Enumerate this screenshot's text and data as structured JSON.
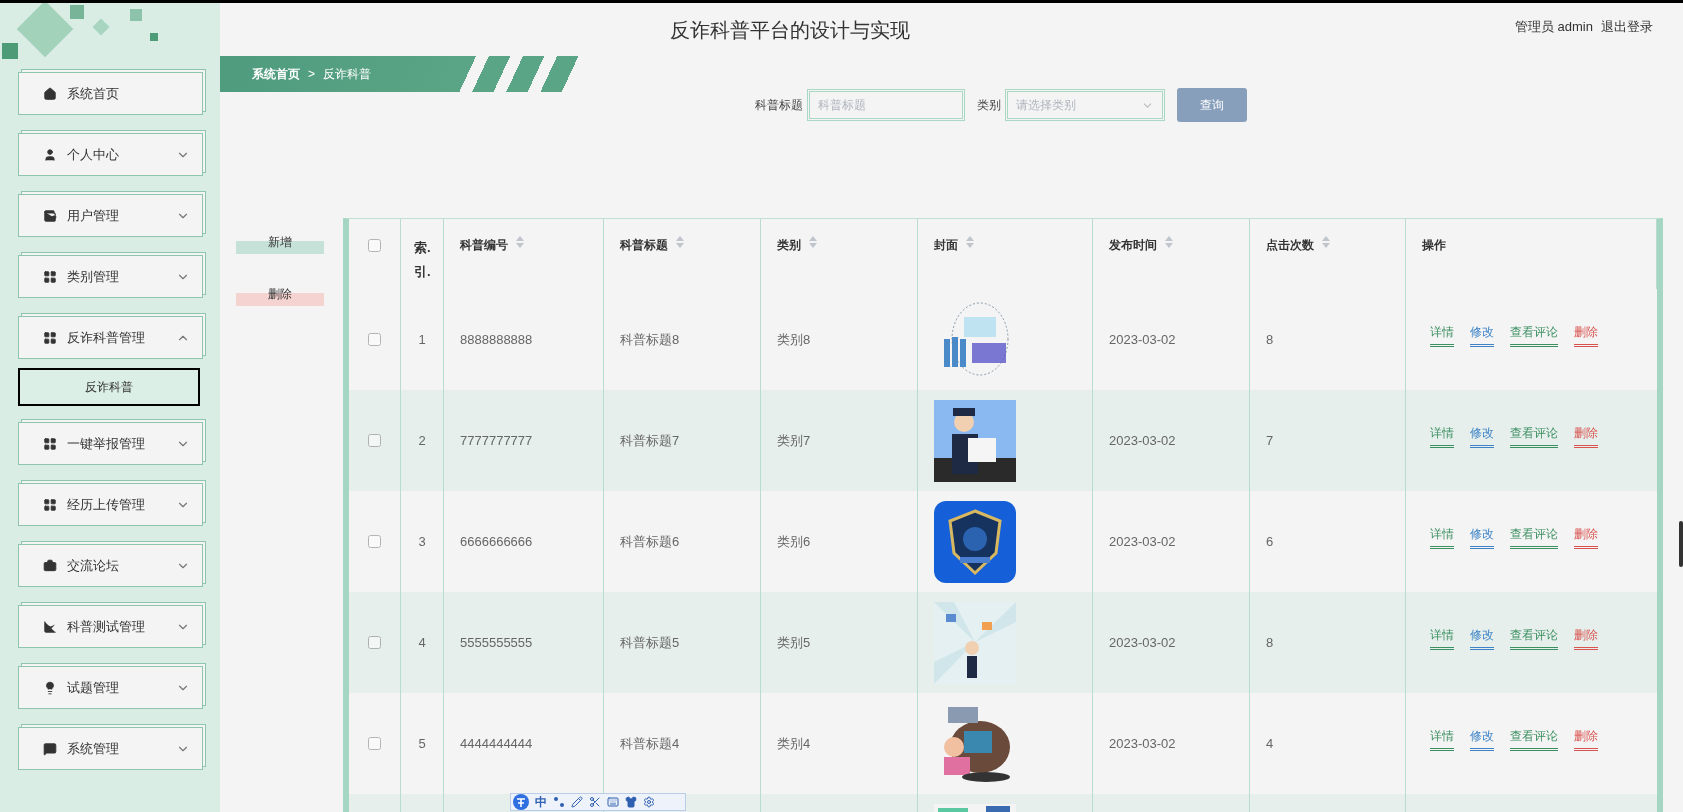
{
  "header": {
    "title": "反诈科普平台的设计与实现",
    "user": "管理员 admin",
    "logout": "退出登录"
  },
  "sidebar": {
    "items": [
      {
        "label": "系统首页",
        "kind": "link"
      },
      {
        "label": "个人中心",
        "kind": "menu",
        "expanded": false
      },
      {
        "label": "用户管理",
        "kind": "menu",
        "expanded": false
      },
      {
        "label": "类别管理",
        "kind": "menu",
        "expanded": false
      },
      {
        "label": "反诈科普管理",
        "kind": "menu",
        "expanded": true,
        "children": [
          {
            "label": "反诈科普",
            "selected": true
          }
        ]
      },
      {
        "label": "一键举报管理",
        "kind": "menu",
        "expanded": false
      },
      {
        "label": "经历上传管理",
        "kind": "menu",
        "expanded": false
      },
      {
        "label": "交流论坛",
        "kind": "menu",
        "expanded": false
      },
      {
        "label": "科普测试管理",
        "kind": "menu",
        "expanded": false
      },
      {
        "label": "试题管理",
        "kind": "menu",
        "expanded": false
      },
      {
        "label": "系统管理",
        "kind": "menu",
        "expanded": false
      }
    ]
  },
  "breadcrumb": [
    "系统首页",
    "反诈科普"
  ],
  "breadcrumb_separator": ">",
  "search": {
    "fields": [
      {
        "label": "科普标题",
        "placeholder": "科普标题",
        "kind": "input"
      },
      {
        "label": "类别",
        "placeholder": "请选择类别",
        "kind": "select"
      }
    ],
    "button": "查询"
  },
  "toolbar": [
    {
      "label": "新增",
      "kind": "add"
    },
    {
      "label": "删除",
      "kind": "delete"
    }
  ],
  "table": {
    "select_all": {
      "checked": false
    },
    "columns": [
      {
        "label": "索.引.",
        "sortable": false
      },
      {
        "label": "科普编号",
        "sortable": true
      },
      {
        "label": "科普标题",
        "sortable": true
      },
      {
        "label": "类别",
        "sortable": true
      },
      {
        "label": "封面",
        "sortable": true
      },
      {
        "label": "发布时间",
        "sortable": true
      },
      {
        "label": "点击次数",
        "sortable": true
      },
      {
        "label": "操作",
        "sortable": false
      }
    ],
    "rows": [
      {
        "checked": false,
        "index": "1",
        "number": "8888888888",
        "title": "科普标题8",
        "category": "类别8",
        "cover": {
          "kind": "picture"
        },
        "date": "2023-03-02",
        "clicks": "8",
        "actions": [
          {
            "label": "详情",
            "kind": "detail"
          },
          {
            "label": "修改",
            "kind": "edit"
          },
          {
            "label": "查看评论",
            "kind": "comments"
          },
          {
            "label": "删除",
            "kind": "delete"
          }
        ]
      },
      {
        "checked": false,
        "index": "2",
        "number": "7777777777",
        "title": "科普标题7",
        "category": "类别7",
        "cover": {
          "kind": "picture"
        },
        "date": "2023-03-02",
        "clicks": "7",
        "actions": [
          {
            "label": "详情",
            "kind": "detail"
          },
          {
            "label": "修改",
            "kind": "edit"
          },
          {
            "label": "查看评论",
            "kind": "comments"
          },
          {
            "label": "删除",
            "kind": "delete"
          }
        ]
      },
      {
        "checked": false,
        "index": "3",
        "number": "6666666666",
        "title": "科普标题6",
        "category": "类别6",
        "cover": {
          "kind": "picture"
        },
        "date": "2023-03-02",
        "clicks": "6",
        "actions": [
          {
            "label": "详情",
            "kind": "detail"
          },
          {
            "label": "修改",
            "kind": "edit"
          },
          {
            "label": "查看评论",
            "kind": "comments"
          },
          {
            "label": "删除",
            "kind": "delete"
          }
        ]
      },
      {
        "checked": false,
        "index": "4",
        "number": "5555555555",
        "title": "科普标题5",
        "category": "类别5",
        "cover": {
          "kind": "picture"
        },
        "date": "2023-03-02",
        "clicks": "8",
        "actions": [
          {
            "label": "详情",
            "kind": "detail"
          },
          {
            "label": "修改",
            "kind": "edit"
          },
          {
            "label": "查看评论",
            "kind": "comments"
          },
          {
            "label": "删除",
            "kind": "delete"
          }
        ]
      },
      {
        "checked": false,
        "index": "5",
        "number": "4444444444",
        "title": "科普标题4",
        "category": "类别4",
        "cover": {
          "kind": "picture"
        },
        "date": "2023-03-02",
        "clicks": "4",
        "actions": [
          {
            "label": "详情",
            "kind": "detail"
          },
          {
            "label": "修改",
            "kind": "edit"
          },
          {
            "label": "查看评论",
            "kind": "comments"
          },
          {
            "label": "删除",
            "kind": "delete"
          }
        ]
      },
      {
        "cover": {
          "kind": "picture"
        }
      }
    ]
  },
  "ime_toolbar": {
    "mode": "中"
  }
}
